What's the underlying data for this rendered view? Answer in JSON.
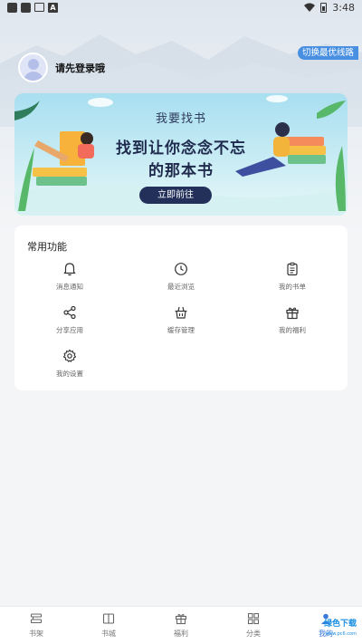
{
  "status_bar": {
    "time": "3:48"
  },
  "top": {
    "switch_line_label": "切换最优线路"
  },
  "user": {
    "login_prompt": "请先登录哦"
  },
  "banner": {
    "subtitle": "我要找书",
    "title_line1": "找到让你念念不忘",
    "title_line2": "的那本书",
    "button_label": "立即前往"
  },
  "functions": {
    "title": "常用功能",
    "items": [
      {
        "label": "消息通知",
        "icon": "bell-icon"
      },
      {
        "label": "最近浏览",
        "icon": "clock-icon"
      },
      {
        "label": "我的书单",
        "icon": "clipboard-icon"
      },
      {
        "label": "分享应用",
        "icon": "share-icon"
      },
      {
        "label": "缓存管理",
        "icon": "basket-icon"
      },
      {
        "label": "我的福利",
        "icon": "gift-icon"
      },
      {
        "label": "我的设置",
        "icon": "gear-icon"
      }
    ]
  },
  "tabbar": {
    "items": [
      {
        "label": "书架",
        "icon": "bookshelf-icon"
      },
      {
        "label": "书城",
        "icon": "book-icon"
      },
      {
        "label": "福利",
        "icon": "gift-icon"
      },
      {
        "label": "分类",
        "icon": "grid-icon"
      },
      {
        "label": "我的",
        "icon": "person-icon"
      }
    ]
  },
  "watermark": {
    "text": "绿色下载",
    "sub": "www.pc6.com"
  },
  "colors": {
    "accent": "#3a78d8",
    "banner_button": "#22305a",
    "switch_badge": "#4a90e2"
  }
}
